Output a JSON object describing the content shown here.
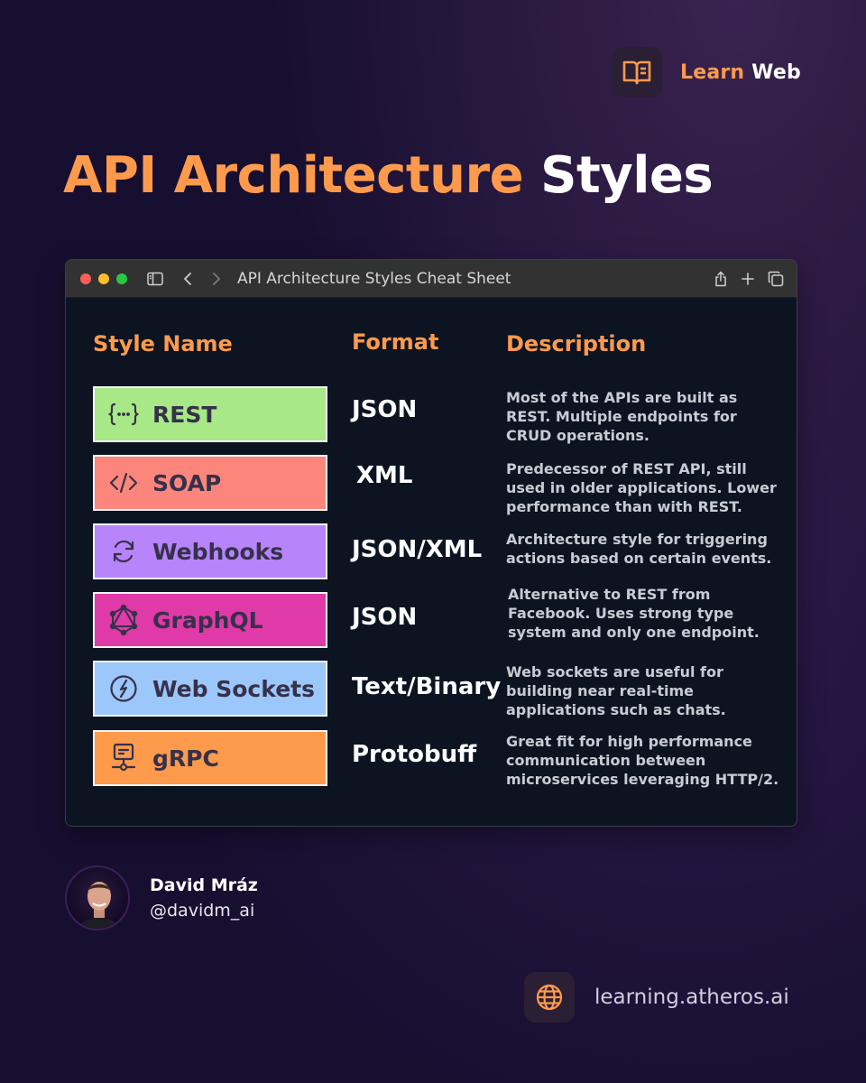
{
  "brand": {
    "icon": "book-icon",
    "word1": "Learn",
    "word2": "Web"
  },
  "headline": {
    "part1": "API Architecture",
    "part2": "Styles"
  },
  "window": {
    "title": "API Architecture Styles Cheat Sheet",
    "dot_colors": [
      "#ff5f57",
      "#febc2e",
      "#28c840"
    ],
    "toolbar_icons": [
      "sidebar-icon",
      "chevron-left-icon",
      "chevron-right-icon",
      "share-icon",
      "plus-icon",
      "tabs-icon"
    ]
  },
  "table": {
    "headers": {
      "style": "Style Name",
      "format": "Format",
      "description": "Description"
    },
    "rows": [
      {
        "name": "REST",
        "icon": "braces-icon",
        "color": "#a8e887",
        "format": "JSON",
        "description": "Most of the APIs are built as REST. Multiple endpoints for CRUD operations."
      },
      {
        "name": "SOAP",
        "icon": "code-icon",
        "color": "#fd867c",
        "format": "XML",
        "description": "Predecessor of REST API, still used in older applications. Lower performance than with REST."
      },
      {
        "name": "Webhooks",
        "icon": "refresh-icon",
        "color": "#b784fb",
        "format": "JSON/XML",
        "description": "Architecture style for triggering actions based on certain events."
      },
      {
        "name": "GraphQL",
        "icon": "graphql-icon",
        "color": "#df3aa8",
        "format": "JSON",
        "description": "Alternative to REST from Facebook. Uses strong type system and only one endpoint."
      },
      {
        "name": "Web Sockets",
        "icon": "bolt-circle-icon",
        "color": "#9cc7fb",
        "format": "Text/Binary",
        "description": "Web sockets are useful for building near real-time applications such as chats."
      },
      {
        "name": "gRPC",
        "icon": "presentation-icon",
        "color": "#fd9a4c",
        "format": "Protobuff",
        "description": "Great fit for high performance communication between microservices leveraging HTTP/2."
      }
    ]
  },
  "author": {
    "name": "David Mráz",
    "handle": "@davidm_ai"
  },
  "site": {
    "icon": "globe-icon",
    "url": "learning.atheros.ai"
  }
}
